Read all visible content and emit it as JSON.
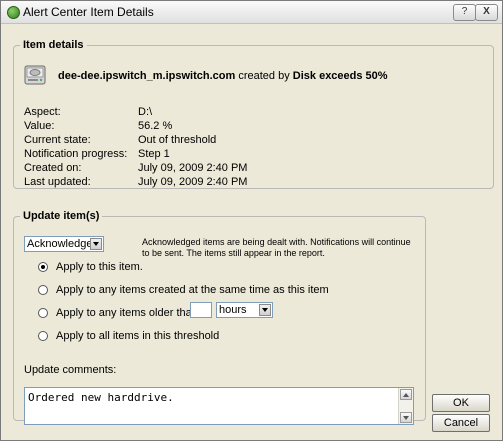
{
  "window": {
    "title": "Alert Center Item Details",
    "help_label": "?",
    "close_label": "X"
  },
  "details": {
    "legend": "Item details",
    "host": "dee-dee.ipswitch_m.ipswitch.com",
    "created_by_text": "created by",
    "monitor": "Disk exceeds 50%",
    "fields": [
      {
        "label": "Aspect:",
        "value": "D:\\"
      },
      {
        "label": "Value:",
        "value": "56.2 %"
      },
      {
        "label": "Current state:",
        "value": "Out of threshold"
      },
      {
        "label": "Notification progress:",
        "value": "Step 1"
      },
      {
        "label": "Created on:",
        "value": "July 09, 2009 2:40 PM"
      },
      {
        "label": "Last updated:",
        "value": "July 09, 2009 2:40 PM"
      }
    ]
  },
  "update": {
    "legend": "Update item(s)",
    "action_selected": "Acknowledge",
    "note": "Acknowledged items are being dealt with. Notifications will continue to be sent. The items still appear in the report.",
    "options": [
      {
        "label": "Apply to this item.",
        "checked": true
      },
      {
        "label": "Apply to any items created at the same time as this item",
        "checked": false
      },
      {
        "label": "Apply to any items older than",
        "checked": false
      },
      {
        "label": "Apply to all items in this threshold",
        "checked": false
      }
    ],
    "older_than_value": "",
    "older_than_unit": "hours",
    "comments_label": "Update comments:",
    "comments_value": "Ordered new harddrive."
  },
  "buttons": {
    "ok": "OK",
    "cancel": "Cancel"
  },
  "icons": {
    "app": "green-circle-icon",
    "drive": "hard-drive-icon"
  }
}
